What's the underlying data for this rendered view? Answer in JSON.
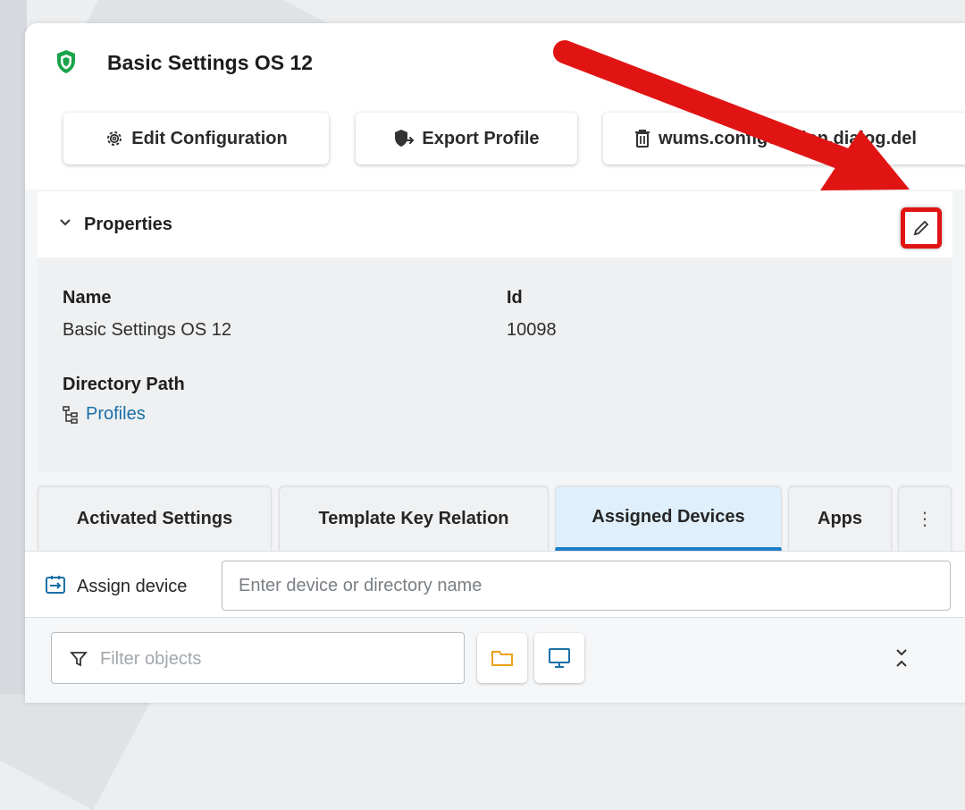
{
  "header": {
    "title": "Basic Settings OS 12",
    "icon": "shield-icon",
    "icon_color": "#1aa34a"
  },
  "toolbar": {
    "edit_label": "Edit Configuration",
    "export_label": "Export Profile",
    "delete_label": "wums.configuration.dialog.del"
  },
  "properties": {
    "title": "Properties",
    "name_label": "Name",
    "name_value": "Basic Settings OS 12",
    "id_label": "Id",
    "id_value": "10098",
    "dir_label": "Directory Path",
    "dir_value": "Profiles"
  },
  "tabs": [
    {
      "label": "Activated Settings"
    },
    {
      "label": "Template Key Relation"
    },
    {
      "label": "Assigned Devices",
      "active": true
    },
    {
      "label": "Apps"
    },
    {
      "label": "⋮"
    }
  ],
  "assign": {
    "label": "Assign device",
    "placeholder": "Enter device or directory name"
  },
  "filter": {
    "placeholder": "Filter objects"
  },
  "colors": {
    "accent": "#1a7ec8",
    "highlight": "#e11414",
    "link": "#1b6fa8",
    "folder": "#e8a21a",
    "device": "#1b6fa8"
  }
}
